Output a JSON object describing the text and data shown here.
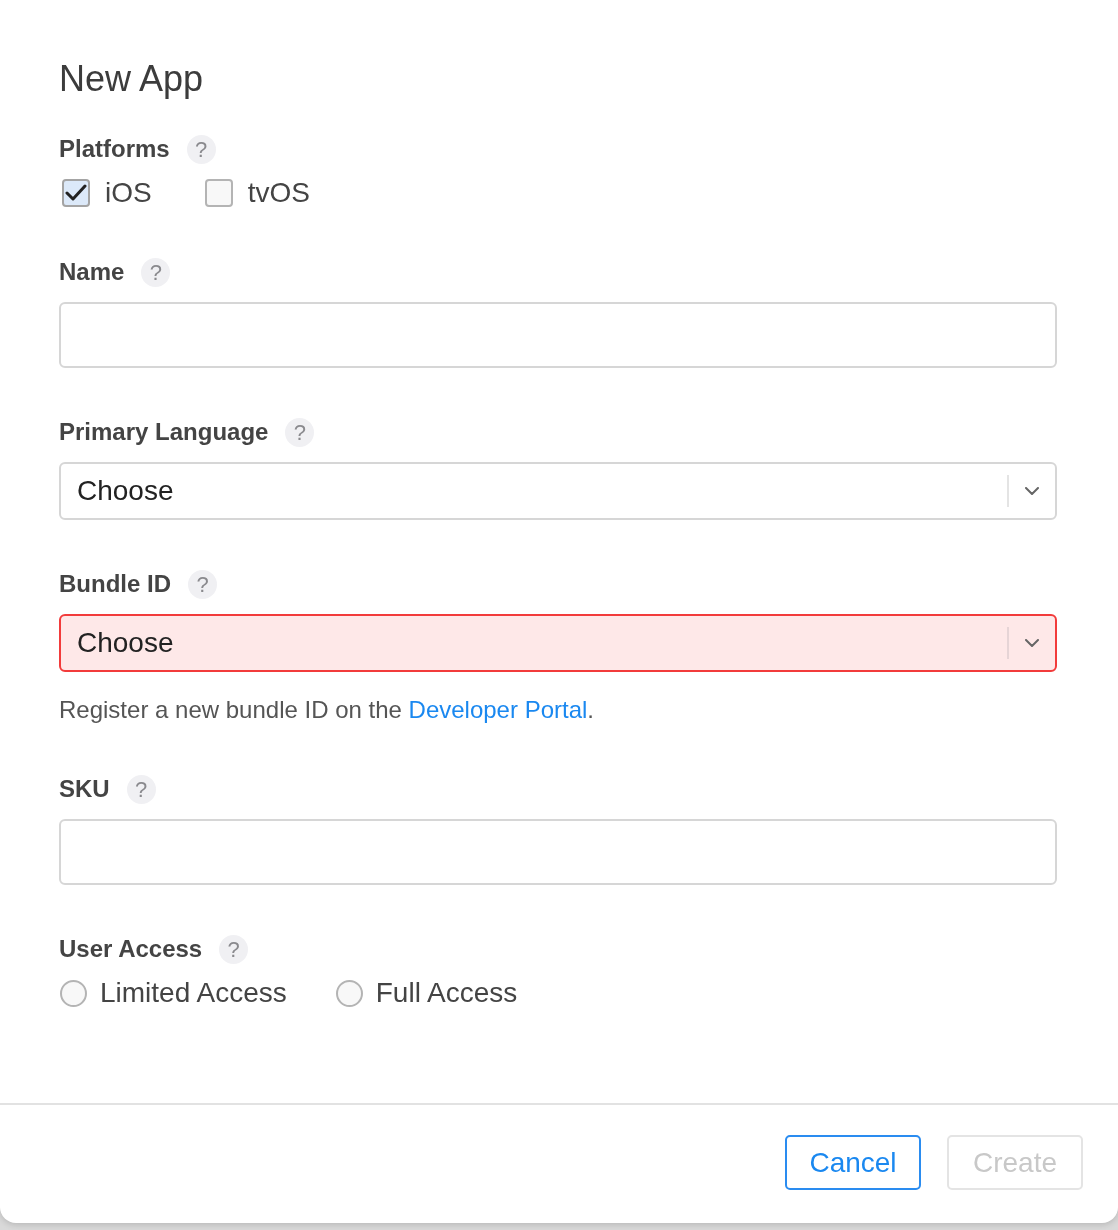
{
  "dialog": {
    "title": "New App"
  },
  "fields": [
    {
      "kind": "checkboxes",
      "label": "Platforms",
      "help": "?",
      "options": [
        {
          "label": "iOS",
          "checked": true
        },
        {
          "label": "tvOS",
          "checked": false
        }
      ]
    },
    {
      "kind": "text",
      "label": "Name",
      "help": "?"
    },
    {
      "kind": "select",
      "label": "Primary Language",
      "help": "?",
      "value": "Choose",
      "invalid": false
    },
    {
      "kind": "select",
      "label": "Bundle ID",
      "help": "?",
      "value": "Choose",
      "invalid": true,
      "note": {
        "text": "Register a new bundle ID on the",
        "link": "Developer Portal",
        "after": "."
      }
    },
    {
      "kind": "text",
      "label": "SKU",
      "help": "?"
    },
    {
      "kind": "radios",
      "label": "User Access",
      "help": "?",
      "options": [
        {
          "label": "Limited Access",
          "selected": false
        },
        {
          "label": "Full Access",
          "selected": false
        }
      ]
    }
  ],
  "buttons": [
    {
      "label": "Cancel",
      "disabled": false
    },
    {
      "label": "Create",
      "disabled": true
    }
  ]
}
